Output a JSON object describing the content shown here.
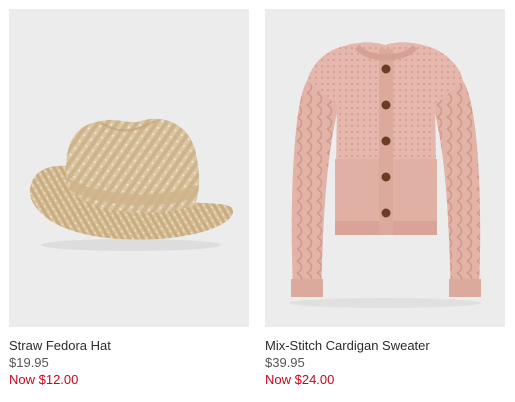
{
  "products": [
    {
      "name": "Straw Fedora Hat",
      "original_price": "$19.95",
      "sale_price": "Now $12.00",
      "image_icon": "straw-fedora-hat-image"
    },
    {
      "name": "Mix-Stitch Cardigan Sweater",
      "original_price": "$39.95",
      "sale_price": "Now $24.00",
      "image_icon": "pink-cardigan-sweater-image"
    }
  ],
  "colors": {
    "image_background": "#ececec",
    "name_text": "#2b2b2b",
    "original_price_text": "#555555",
    "sale_price_text": "#d0021b",
    "straw": "#dcc7a4",
    "cardigan_pink": "#e6b8ad",
    "button_brown": "#6b3d24"
  }
}
